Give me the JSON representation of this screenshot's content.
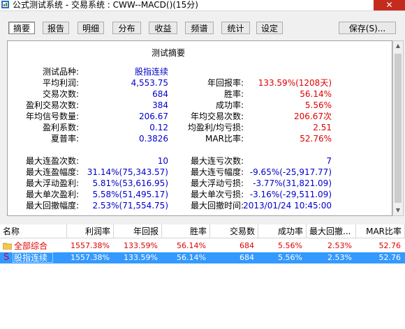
{
  "window": {
    "title": "公式测试系统 - 交易系统 : CWW--MACD()(15分)",
    "close_label": "✕"
  },
  "tabs": [
    {
      "label": "摘要",
      "active": true
    },
    {
      "label": "报告"
    },
    {
      "label": "明细"
    },
    {
      "label": "分布"
    },
    {
      "label": "收益"
    },
    {
      "label": "频谱"
    },
    {
      "label": "统计"
    },
    {
      "label": "设定"
    }
  ],
  "save_button": "保存(S)...",
  "summary": {
    "title": "测试摘要",
    "left": [
      {
        "label": "测试品种:",
        "value": "股指连续"
      },
      {
        "label": "平均利润:",
        "value": "4,553.75"
      },
      {
        "label": "交易次数:",
        "value": "684"
      },
      {
        "label": "盈利交易次数:",
        "value": "384"
      },
      {
        "label": "年均信号数量:",
        "value": "206.67"
      },
      {
        "label": "盈利系数:",
        "value": "0.12"
      },
      {
        "label": "夏普率:",
        "value": "0.3826"
      },
      {
        "label": "最大连盈次数:",
        "value": "10"
      },
      {
        "label": "最大连盈幅度:",
        "value": "31.14%(75,343.57)"
      },
      {
        "label": "最大浮动盈利:",
        "value": "5.81%(53,616.95)"
      },
      {
        "label": "最大单次盈利:",
        "value": "5.58%(51,495.17)"
      },
      {
        "label": "最大回撤幅度:",
        "value": "2.53%(71,554.75)"
      }
    ],
    "right": [
      {
        "label": "年回报率:",
        "value": "133.59%(1208天)",
        "color": "#e00000"
      },
      {
        "label": "胜率:",
        "value": "56.14%",
        "color": "#e00000"
      },
      {
        "label": "成功率:",
        "value": "5.56%",
        "color": "#e00000"
      },
      {
        "label": "年均交易次数:",
        "value": "206.67次",
        "color": "#e00000"
      },
      {
        "label": "均盈利/均亏损:",
        "value": "2.51",
        "color": "#e00000"
      },
      {
        "label": "MAR比率:",
        "value": "52.76%",
        "color": "#e00000"
      },
      {
        "label": "最大连亏次数:",
        "value": "7",
        "color": "#0000cc"
      },
      {
        "label": "最大连亏幅度:",
        "value": "-9.65%(-25,917.77)",
        "color": "#0000cc"
      },
      {
        "label": "最大浮动亏损:",
        "value": "-3.77%(31,821.09)",
        "color": "#0000cc"
      },
      {
        "label": "最大单次亏损:",
        "value": "-3.16%(-29,511.09)",
        "color": "#0000cc"
      },
      {
        "label": "最大回撤时间:",
        "value": "2013/01/24 10:45:00",
        "color": "#0000cc"
      }
    ]
  },
  "grid": {
    "headers": [
      "名称",
      "利润率",
      "年回报",
      "胜率",
      "交易数",
      "成功率",
      "最大回撤...",
      "MAR比率"
    ],
    "rows": [
      {
        "name": "全部综合",
        "values": [
          "1557.38%",
          "133.59%",
          "56.14%",
          "684",
          "5.56%",
          "2.53%",
          "52.76"
        ]
      },
      {
        "name": "股指连续",
        "values": [
          "1557.38%",
          "133.59%",
          "56.14%",
          "684",
          "5.56%",
          "2.53%",
          "52.76"
        ]
      }
    ]
  }
}
